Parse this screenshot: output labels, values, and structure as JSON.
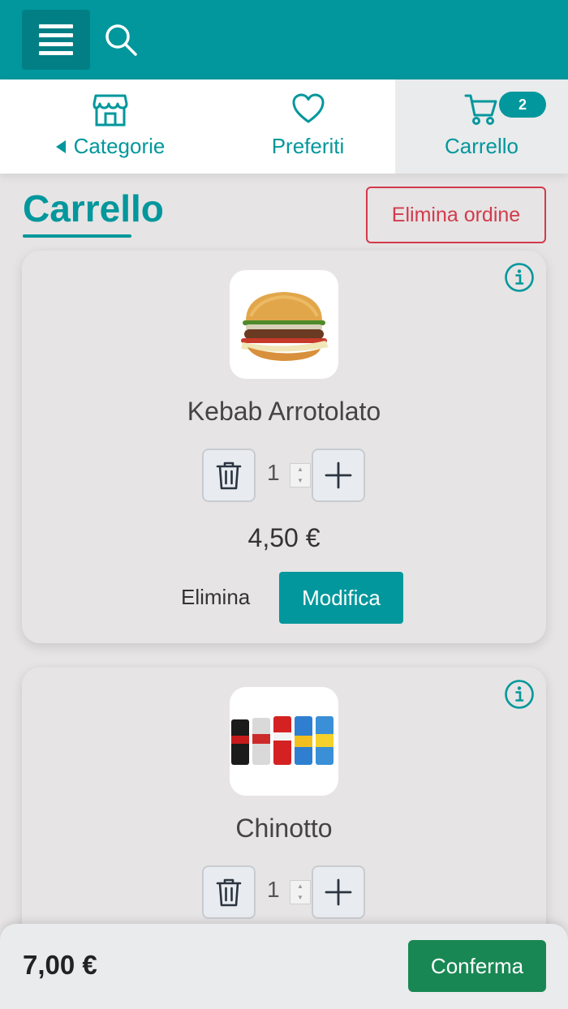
{
  "nav": {
    "categories_label": "Categorie",
    "favorites_label": "Preferiti",
    "cart_label": "Carrello",
    "cart_badge": "2"
  },
  "page": {
    "title": "Carrello",
    "delete_order_label": "Elimina ordine"
  },
  "cart_items": [
    {
      "name": "Kebab Arrotolato",
      "quantity": "1",
      "price": "4,50 €",
      "remove_label": "Elimina",
      "edit_label": "Modifica"
    },
    {
      "name": "Chinotto",
      "quantity": "1"
    }
  ],
  "footer": {
    "total": "7,00 €",
    "confirm_label": "Conferma"
  },
  "colors": {
    "accent": "#02979c",
    "danger": "#d23a4d",
    "success": "#198754"
  },
  "icons": {
    "menu": "hamburger-icon",
    "search": "search-icon",
    "categories": "store-icon",
    "favorites": "heart-icon",
    "cart": "cart-icon",
    "info": "info-icon",
    "trash": "trash-icon",
    "plus": "plus-icon"
  }
}
